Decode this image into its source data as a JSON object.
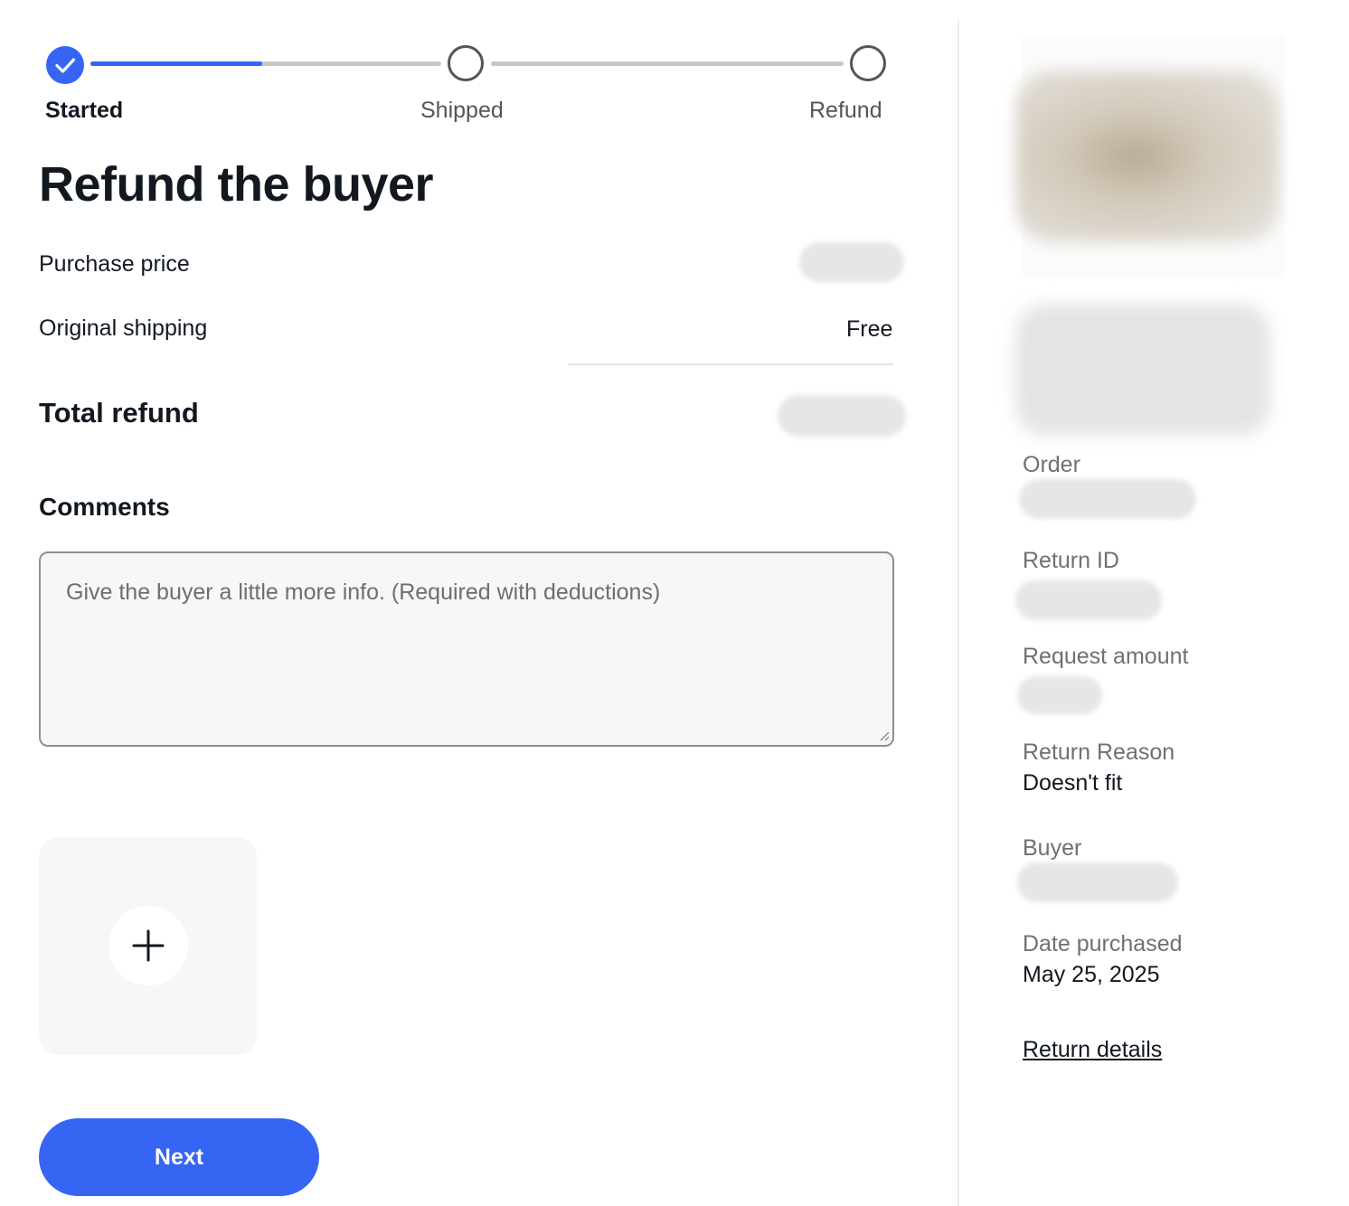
{
  "progress": {
    "steps": [
      {
        "label": "Started",
        "state": "complete"
      },
      {
        "label": "Shipped",
        "state": "incomplete"
      },
      {
        "label": "Refund",
        "state": "incomplete"
      }
    ],
    "segment_fill": 0.49,
    "accent_color": "#3665f3"
  },
  "refund": {
    "title": "Refund the buyer",
    "purchase_price_label": "Purchase price",
    "original_shipping_label": "Original shipping",
    "original_shipping_value": "Free",
    "total_refund_label": "Total refund"
  },
  "comments": {
    "heading": "Comments",
    "placeholder": "Give the buyer a little more info. (Required with deductions)",
    "value": ""
  },
  "upload": {
    "icon": "plus-icon"
  },
  "actions": {
    "next_label": "Next"
  },
  "details": {
    "order_label": "Order",
    "return_id_label": "Return ID",
    "request_amount_label": "Request amount",
    "return_reason_label": "Return Reason",
    "return_reason_value": "Doesn't fit",
    "buyer_label": "Buyer",
    "date_purchased_label": "Date purchased",
    "date_purchased_value": "May 25, 2025",
    "return_details_link": "Return details"
  }
}
